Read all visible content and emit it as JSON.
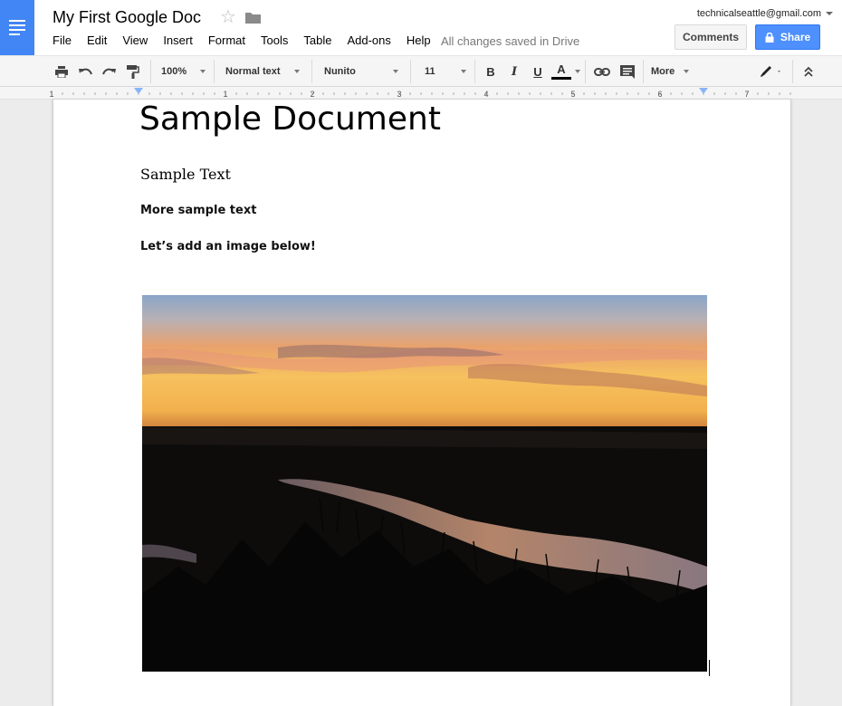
{
  "app": {
    "title": "My First Google Doc",
    "account": "technicalseattle@gmail.com",
    "save_status": "All changes saved in Drive",
    "accent_color": "#4285f4"
  },
  "menu": [
    "File",
    "Edit",
    "View",
    "Insert",
    "Format",
    "Tools",
    "Table",
    "Add-ons",
    "Help"
  ],
  "buttons": {
    "comments": "Comments",
    "share": "Share"
  },
  "toolbar": {
    "zoom": "100%",
    "style": "Normal text",
    "font": "Nunito",
    "size": "11",
    "bold": "B",
    "italic": "I",
    "underline": "U",
    "text_color": "A",
    "more": "More",
    "icons": [
      "print-icon",
      "undo-icon",
      "redo-icon",
      "paint-format-icon",
      "link-icon",
      "comment-icon",
      "pencil-icon",
      "collapse-icon"
    ]
  },
  "ruler": {
    "labels": [
      "1",
      "1",
      "2",
      "3",
      "4",
      "5",
      "6",
      "7"
    ]
  },
  "document": {
    "heading": "Sample Document",
    "paragraphs": [
      "Sample Text",
      "More sample text",
      "Let’s add an image below!"
    ],
    "image": "sunset-over-river-photo"
  }
}
